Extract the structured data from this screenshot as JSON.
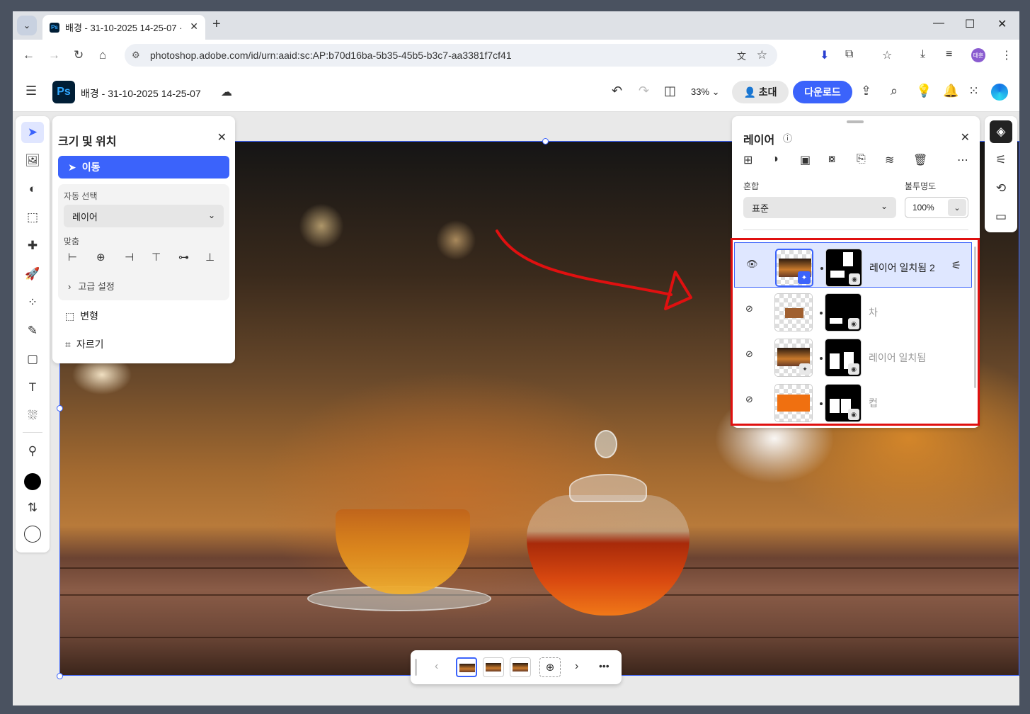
{
  "browser": {
    "tab_title": "배경 - 31-10-2025 14-25-07 ·",
    "tab_favicon": "Ps",
    "url": "photoshop.adobe.com/id/urn:aaid:sc:AP:b70d16ba-5b35-45b5-b3c7-aa3381f7cf41",
    "profile_initials": "태훈",
    "icons": [
      "back-icon",
      "forward-icon",
      "reload-icon",
      "home-icon",
      "site-info-icon",
      "translate-icon",
      "bookmark-star-icon",
      "extension-icon",
      "puzzle-icon",
      "bookmarks-icon",
      "download-icon",
      "media-icon",
      "menu-icon"
    ]
  },
  "header": {
    "logo": "Ps",
    "doc_title": "배경 - 31-10-2025 14-25-07",
    "zoom": "33%",
    "invite_label": "초대",
    "download_label": "다운로드"
  },
  "size_panel": {
    "title": "크기 및 위치",
    "move_label": "이동",
    "auto_select_label": "자동 선택",
    "auto_select_value": "레이어",
    "align_label": "맞춤",
    "advanced_label": "고급 설정",
    "transform_label": "변형",
    "crop_label": "자르기"
  },
  "layers_panel": {
    "title": "레이어",
    "blend_label": "혼합",
    "blend_value": "표준",
    "opacity_label": "불투명도",
    "opacity_value": "100%",
    "layers": [
      {
        "name": "레이어 일치됨 2",
        "visible": true,
        "selected": true
      },
      {
        "name": "차",
        "visible": false,
        "selected": false
      },
      {
        "name": "레이어 일치됨",
        "visible": false,
        "selected": false
      },
      {
        "name": "컵",
        "visible": false,
        "selected": false
      }
    ]
  },
  "colors": {
    "accent": "#3b63fb",
    "annotation_red": "#e01010",
    "foreground": "#000000",
    "background": "#ffffff"
  }
}
